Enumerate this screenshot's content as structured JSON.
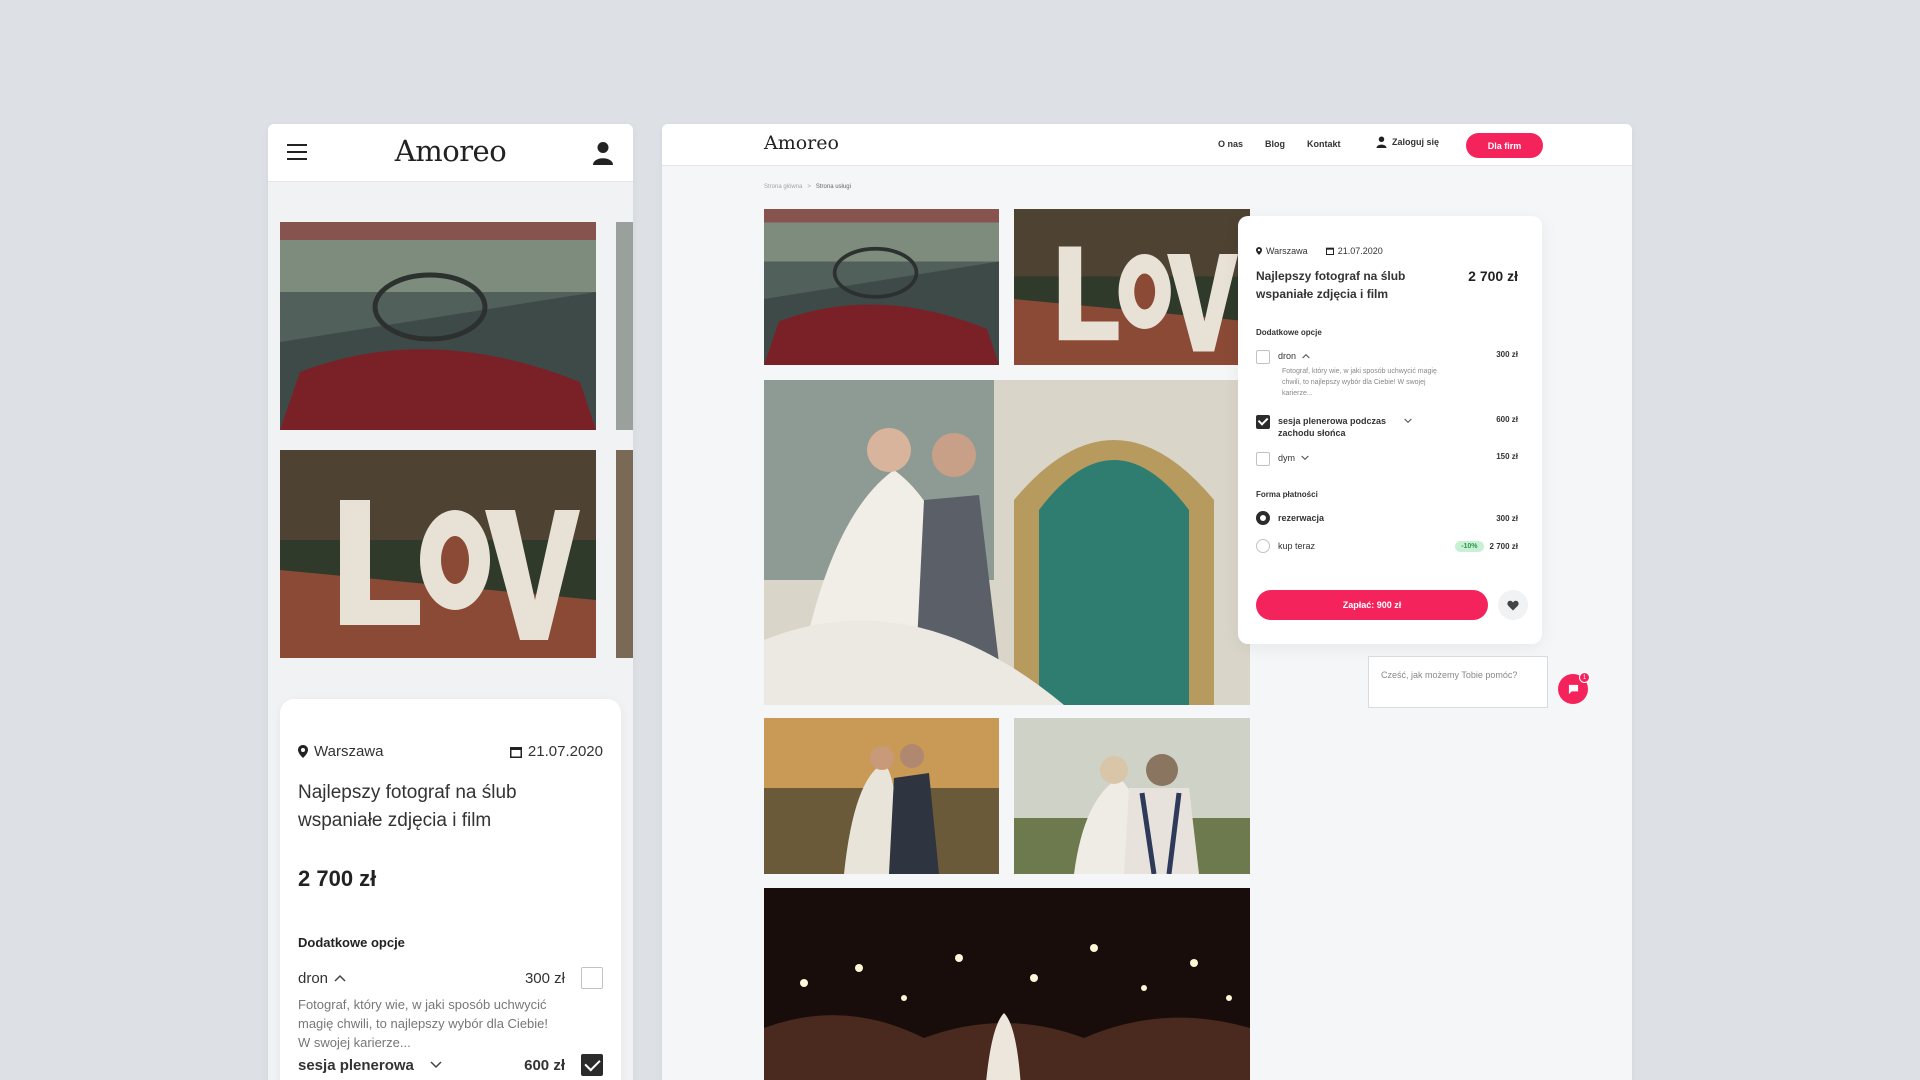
{
  "brand": {
    "logo": "Amoreo",
    "accent": "#f5235b"
  },
  "listing": {
    "location": "Warszawa",
    "date": "21.07.2020",
    "title": "Najlepszy fotograf na ślub wspaniałe zdjęcia i film",
    "price": "2 700 zł",
    "extras_label": "Dodatkowe opcje",
    "options": [
      {
        "name": "dron",
        "price": "300 zł",
        "checked": false,
        "desc": "Fotograf, który wie, w jaki sposób uchwycić magię chwili, to najlepszy wybór dla Ciebie! W swojej karierze..."
      },
      {
        "name": "sesja plenerowa podczas zachodu słońca",
        "short": "sesja plenerowa",
        "price": "600 zł",
        "checked": true
      },
      {
        "name": "dym",
        "price": "150 zł",
        "checked": false
      }
    ],
    "payment_label": "Forma płatności",
    "payments": [
      {
        "name": "rezerwacja",
        "price": "300 zł",
        "selected": true
      },
      {
        "name": "kup teraz",
        "badge": "-10%",
        "price": "2 700 zł",
        "selected": false
      }
    ],
    "pay_button": "Zapłać: 900 zł"
  },
  "desktop": {
    "nav": [
      "O nas",
      "Blog",
      "Kontakt"
    ],
    "login": "Zaloguj się",
    "cta": "Dla firm",
    "breadcrumb": [
      "Strona główna",
      ">",
      "Strona usługi"
    ],
    "chat_prompt": "Cześć, jak możemy Tobie pomóc?",
    "chat_count": "1"
  },
  "icons": [
    "menu-icon",
    "user-icon",
    "location-pin-icon",
    "calendar-icon",
    "chevron-up-icon",
    "chevron-down-icon",
    "heart-icon",
    "chat-icon"
  ]
}
